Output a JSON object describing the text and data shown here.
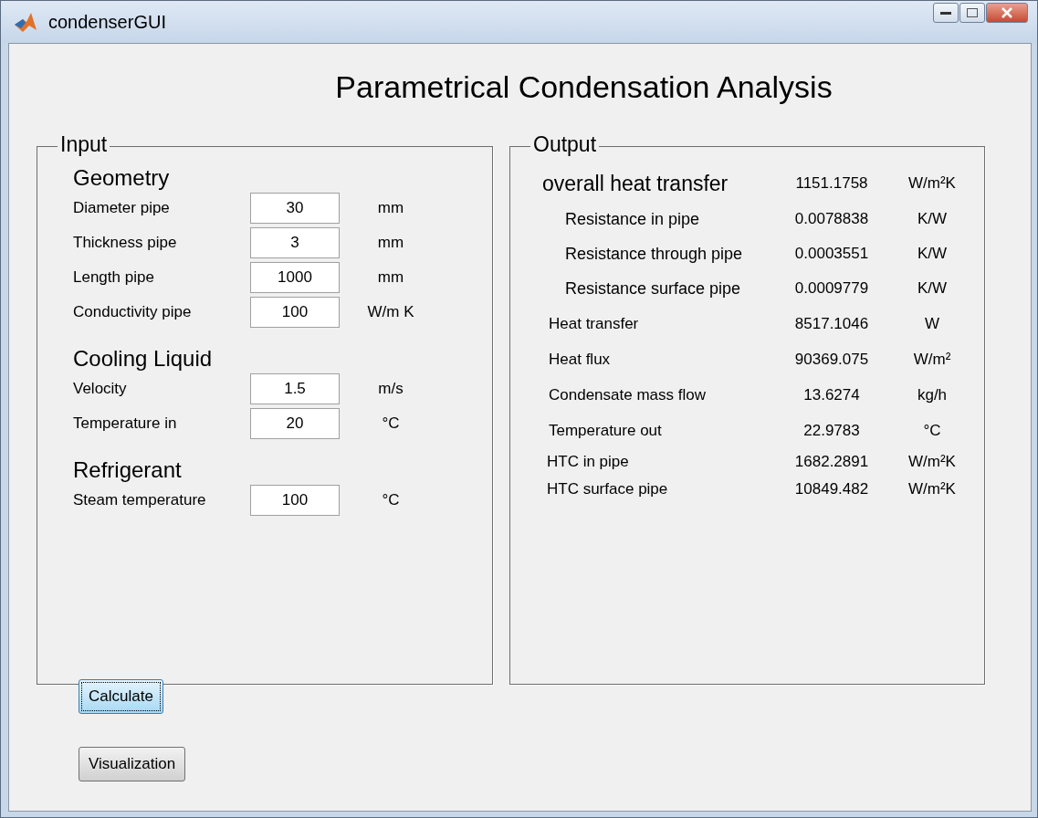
{
  "window": {
    "title": "condenserGUI"
  },
  "heading": "Parametrical Condensation Analysis",
  "input": {
    "title": "Input",
    "sections": [
      {
        "title": "Geometry",
        "fields": [
          {
            "label": "Diameter pipe",
            "value": "30",
            "unit": "mm"
          },
          {
            "label": "Thickness pipe",
            "value": "3",
            "unit": "mm"
          },
          {
            "label": "Length pipe",
            "value": "1000",
            "unit": "mm"
          },
          {
            "label": "Conductivity pipe",
            "value": "100",
            "unit": "W/m K"
          }
        ]
      },
      {
        "title": "Cooling Liquid",
        "fields": [
          {
            "label": "Velocity",
            "value": "1.5",
            "unit": "m/s"
          },
          {
            "label": "Temperature in",
            "value": "20",
            "unit": "°C"
          }
        ]
      },
      {
        "title": "Refrigerant",
        "fields": [
          {
            "label": "Steam temperature",
            "value": "100",
            "unit": "°C"
          }
        ]
      }
    ]
  },
  "output": {
    "title": "Output",
    "rows": [
      {
        "kind": "main",
        "label": "overall heat transfer",
        "value": "1151.1758",
        "unit": "W/m²K"
      },
      {
        "kind": "sub",
        "label": "Resistance in pipe",
        "value": "0.0078838",
        "unit": "K/W"
      },
      {
        "kind": "sub",
        "label": "Resistance through pipe",
        "value": "0.0003551",
        "unit": "K/W"
      },
      {
        "kind": "sub",
        "label": "Resistance surface pipe",
        "value": "0.0009779",
        "unit": "K/W"
      },
      {
        "kind": "plain",
        "label": "Heat transfer",
        "value": "8517.1046",
        "unit": "W"
      },
      {
        "kind": "plain",
        "label": "Heat flux",
        "value": "90369.075",
        "unit": "W/m²"
      },
      {
        "kind": "plain",
        "label": "Condensate mass flow",
        "value": "13.6274",
        "unit": "kg/h"
      },
      {
        "kind": "plain",
        "label": "Temperature out",
        "value": "22.9783",
        "unit": "°C"
      },
      {
        "kind": "tight",
        "label": "HTC in pipe",
        "value": "1682.2891",
        "unit": "W/m²K"
      },
      {
        "kind": "tight",
        "label": "HTC surface pipe",
        "value": "10849.482",
        "unit": "W/m²K"
      }
    ]
  },
  "buttons": [
    {
      "label": "Calculate",
      "focused": true
    },
    {
      "label": "Visualization",
      "focused": false
    }
  ]
}
